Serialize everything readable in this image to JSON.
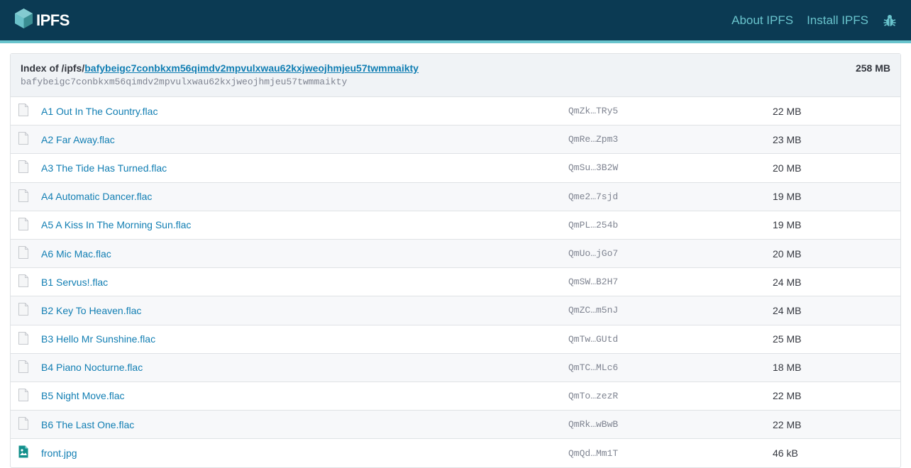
{
  "header": {
    "logo_text": "IPFS",
    "nav": [
      {
        "label": "About IPFS"
      },
      {
        "label": "Install IPFS"
      }
    ],
    "colors": {
      "bar": "#0b3a53",
      "accent": "#69c4cd"
    }
  },
  "index": {
    "prefix": "Index of /ipfs/",
    "cid": "bafybeigc7conbkxm56qimdv2mpvulxwau62kxjweojhmjeu57twmmaikty",
    "total_size": "258 MB"
  },
  "files": [
    {
      "name": "A1 Out In The Country.flac",
      "hash": "QmZk…TRy5",
      "size": "22 MB",
      "icon": "file-icon"
    },
    {
      "name": "A2 Far Away.flac",
      "hash": "QmRe…Zpm3",
      "size": "23 MB",
      "icon": "file-icon"
    },
    {
      "name": "A3 The Tide Has Turned.flac",
      "hash": "QmSu…3B2W",
      "size": "20 MB",
      "icon": "file-icon"
    },
    {
      "name": "A4 Automatic Dancer.flac",
      "hash": "Qme2…7sjd",
      "size": "19 MB",
      "icon": "file-icon"
    },
    {
      "name": "A5 A Kiss In The Morning Sun.flac",
      "hash": "QmPL…254b",
      "size": "19 MB",
      "icon": "file-icon"
    },
    {
      "name": "A6 Mic Mac.flac",
      "hash": "QmUo…jGo7",
      "size": "20 MB",
      "icon": "file-icon"
    },
    {
      "name": "B1 Servus!.flac",
      "hash": "QmSW…B2H7",
      "size": "24 MB",
      "icon": "file-icon"
    },
    {
      "name": "B2 Key To Heaven.flac",
      "hash": "QmZC…m5nJ",
      "size": "24 MB",
      "icon": "file-icon"
    },
    {
      "name": "B3 Hello Mr Sunshine.flac",
      "hash": "QmTw…GUtd",
      "size": "25 MB",
      "icon": "file-icon"
    },
    {
      "name": "B4 Piano Nocturne.flac",
      "hash": "QmTC…MLc6",
      "size": "18 MB",
      "icon": "file-icon"
    },
    {
      "name": "B5 Night Move.flac",
      "hash": "QmTo…zezR",
      "size": "22 MB",
      "icon": "file-icon"
    },
    {
      "name": "B6 The Last One.flac",
      "hash": "QmRk…wBwB",
      "size": "22 MB",
      "icon": "file-icon"
    },
    {
      "name": "front.jpg",
      "hash": "QmQd…Mm1T",
      "size": "46 kB",
      "icon": "image-file-icon"
    }
  ]
}
